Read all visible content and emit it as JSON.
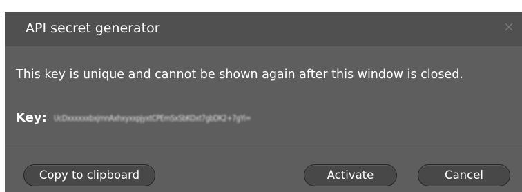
{
  "dialog": {
    "title": "API secret generator",
    "close_icon": "close-icon",
    "message": "This key is unique and cannot be shown again after this window is closed.",
    "key_label": "Key:",
    "key_value": "UcDxxxxxxbxjmnAxhxyxxpjyxtCPEmSxSbKOxt7gbDK2+7gYi=",
    "buttons": {
      "copy_label": "Copy to clipboard",
      "activate_label": "Activate",
      "cancel_label": "Cancel"
    }
  },
  "colors": {
    "dialog_background": "#5e5e5e",
    "titlebar_background": "#505050",
    "button_background": "#484848",
    "text": "#ffffff"
  }
}
